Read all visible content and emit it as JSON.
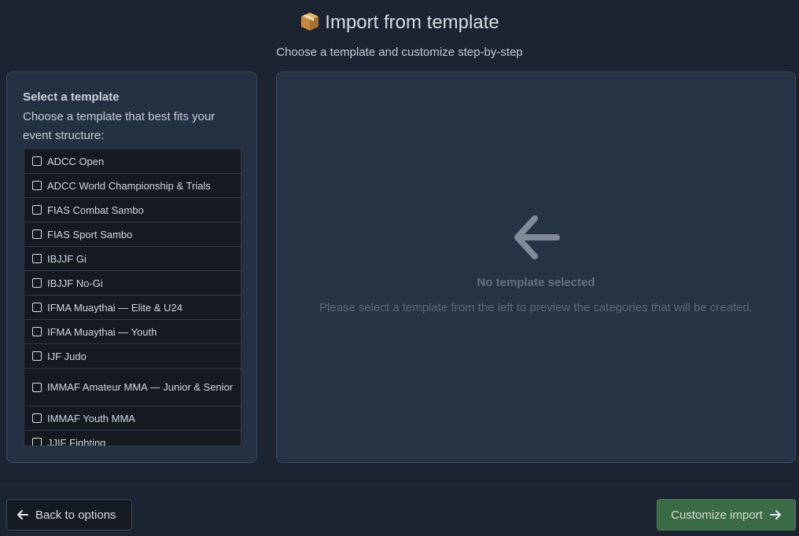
{
  "header": {
    "icon": "package-icon",
    "title": "Import from template",
    "subtitle": "Choose a template and customize step-by-step"
  },
  "template_list": {
    "heading": "Select a template",
    "description": "Choose a template that best fits your event structure:",
    "items": [
      {
        "label": "ADCC Open"
      },
      {
        "label": "ADCC World Championship & Trials"
      },
      {
        "label": "FIAS Combat Sambo"
      },
      {
        "label": "FIAS Sport Sambo"
      },
      {
        "label": "IBJJF Gi"
      },
      {
        "label": "IBJJF No-Gi"
      },
      {
        "label": "IFMA Muaythai — Elite & U24"
      },
      {
        "label": "IFMA Muaythai — Youth"
      },
      {
        "label": "IJF Judo"
      },
      {
        "label": "IMMAF Amateur MMA — Junior & Senior"
      },
      {
        "label": "IMMAF Youth MMA"
      },
      {
        "label": "JJIF Fighting"
      }
    ]
  },
  "preview": {
    "icon": "arrow-left-icon",
    "empty_title": "No template selected",
    "empty_description": "Please select a template from the left to preview the categories that will be created."
  },
  "footer": {
    "back_label": "Back to options",
    "next_label": "Customize import"
  },
  "colors": {
    "background": "#1b2430",
    "panel": "#243142",
    "list_bg": "#151a21",
    "primary_button": "#3a6b44"
  }
}
